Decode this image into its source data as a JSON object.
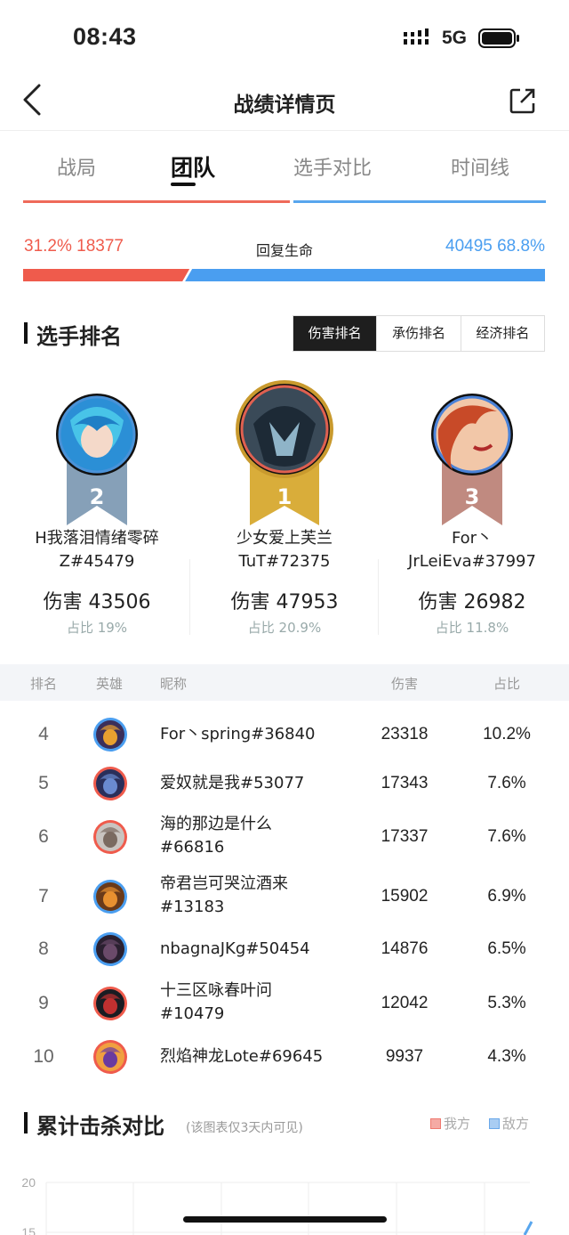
{
  "status": {
    "time": "08:43",
    "network": "5G"
  },
  "nav": {
    "title": "战绩详情页"
  },
  "tabs": [
    {
      "label": "战局",
      "active": false
    },
    {
      "label": "团队",
      "active": true
    },
    {
      "label": "选手对比",
      "active": false
    },
    {
      "label": "时间线",
      "active": false
    }
  ],
  "heal": {
    "left_text": "31.2% 18377",
    "label": "回复生命",
    "right_text": "40495 68.8%",
    "left_fraction": 0.312,
    "colors": {
      "mine": "#ef5b4c",
      "enemy": "#4a9ef0"
    }
  },
  "ranking": {
    "title": "选手排名",
    "segments": [
      {
        "label": "伤害排名",
        "active": true
      },
      {
        "label": "承伤排名",
        "active": false
      },
      {
        "label": "经济排名",
        "active": false
      }
    ],
    "podium": [
      {
        "rank": "2",
        "name_line1": "H我落泪情绪零碎",
        "name_line2": "Z#45479",
        "damage": "伤害 43506",
        "share": "占比 19%"
      },
      {
        "rank": "1",
        "name_line1": "少女爱上芙兰",
        "name_line2": "TuT#72375",
        "damage": "伤害 47953",
        "share": "占比 20.9%"
      },
      {
        "rank": "3",
        "name_line1": "For丶",
        "name_line2": "JrLeiEva#37997",
        "damage": "伤害 26982",
        "share": "占比 11.8%"
      }
    ],
    "table_headers": {
      "rank": "排名",
      "hero": "英雄",
      "nick": "昵称",
      "damage": "伤害",
      "share": "占比"
    },
    "rows": [
      {
        "rank": "4",
        "name": "For丶spring#36840",
        "damage": "23318",
        "share": "10.2%",
        "team": "blue"
      },
      {
        "rank": "5",
        "name": "爱奴就是我#53077",
        "damage": "17343",
        "share": "7.6%",
        "team": "red"
      },
      {
        "rank": "6",
        "name": "海的那边是什么\n#66816",
        "damage": "17337",
        "share": "7.6%",
        "team": "red"
      },
      {
        "rank": "7",
        "name": "帝君岂可哭泣酒来\n#13183",
        "damage": "15902",
        "share": "6.9%",
        "team": "blue"
      },
      {
        "rank": "8",
        "name": "nbagnaJKg#50454",
        "damage": "14876",
        "share": "6.5%",
        "team": "blue"
      },
      {
        "rank": "9",
        "name": "十三区咏春叶问\n#10479",
        "damage": "12042",
        "share": "5.3%",
        "team": "red"
      },
      {
        "rank": "10",
        "name": "烈焰神龙Lote#69645",
        "damage": "9937",
        "share": "4.3%",
        "team": "red"
      }
    ]
  },
  "kills": {
    "title": "累计击杀对比",
    "note": "(该图表仅3天内可见)",
    "legend_mine": "我方",
    "legend_enemy": "敌方",
    "y_ticks": [
      "20",
      "15"
    ]
  },
  "icons": [
    "back-arrow-icon",
    "share-icon",
    "signal-icon",
    "battery-icon",
    "medal-icon",
    "hero-avatar-icon"
  ]
}
